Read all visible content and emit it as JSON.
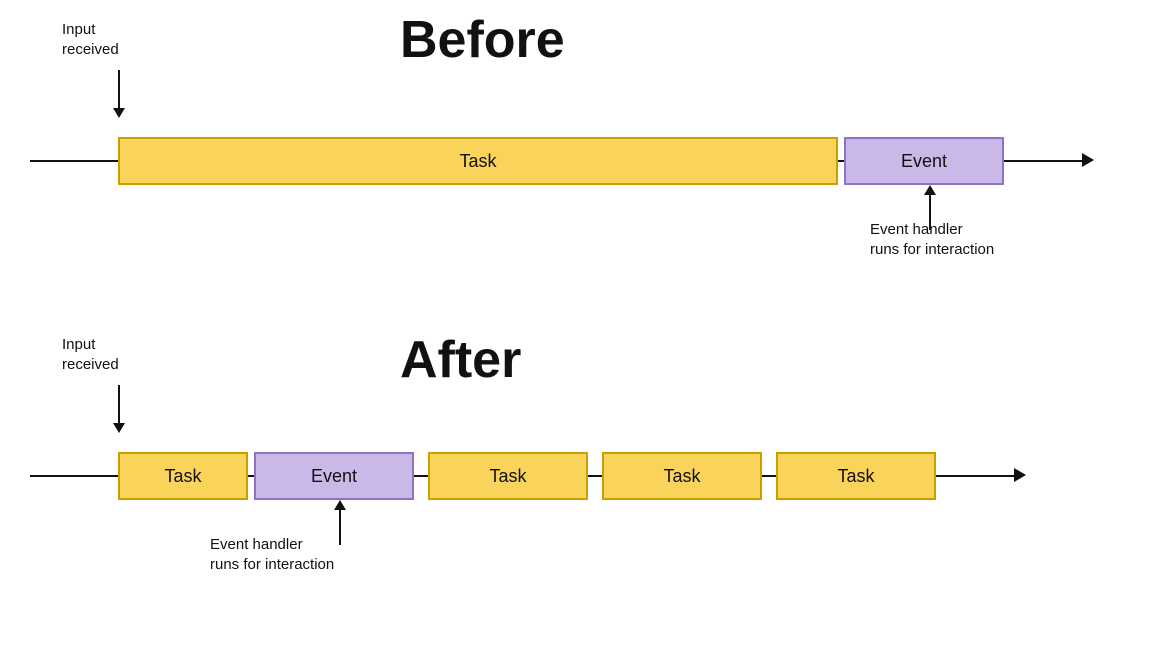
{
  "before": {
    "title": "Before",
    "input_label": "Input\nreceived",
    "event_handler_label": "Event handler\nruns for interaction",
    "task_label": "Task",
    "event_label": "Event"
  },
  "after": {
    "title": "After",
    "input_label": "Input\nreceived",
    "event_handler_label": "Event handler\nruns for interaction",
    "task_label": "Task",
    "event_label": "Event",
    "task2_label": "Task",
    "task3_label": "Task",
    "task4_label": "Task"
  }
}
